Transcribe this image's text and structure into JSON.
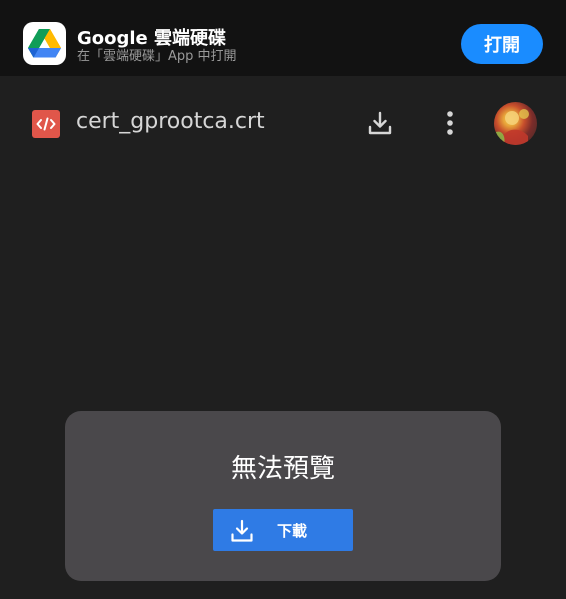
{
  "app_banner": {
    "app_name": "Google 雲端硬碟",
    "subtitle": "在「雲端硬碟」App 中打開",
    "open_label": "打開",
    "icon": "google-drive-icon"
  },
  "viewer": {
    "file_name": "cert_gprootca.crt",
    "file_type_icon": "code-file-icon",
    "download_icon": "download-icon",
    "more_icon": "more-vert-icon"
  },
  "preview": {
    "message": "無法預覽",
    "download_label": "下載",
    "download_icon": "download-icon"
  },
  "colors": {
    "background": "#1f1f1f",
    "banner_background": "#121212",
    "open_button": "#1a8cff",
    "card_background": "#4a484b",
    "download_button": "#2f7be5",
    "file_icon": "#e0564a"
  }
}
